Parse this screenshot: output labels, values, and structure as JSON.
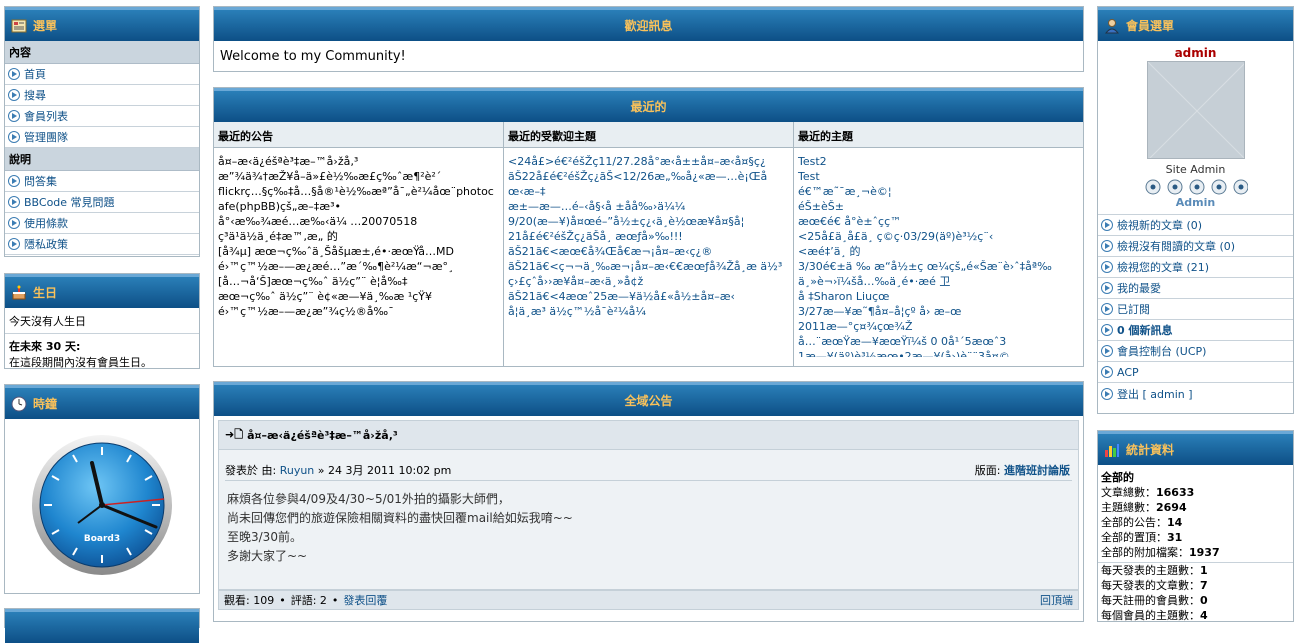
{
  "left": {
    "menu": {
      "title": "選單",
      "sections": [
        {
          "label": "內容",
          "items": [
            "首頁",
            "搜尋",
            "會員列表",
            "管理團隊"
          ]
        },
        {
          "label": "說明",
          "items": [
            "問答集",
            "BBCode 常見問題",
            "使用條款",
            "隱私政策"
          ]
        }
      ]
    },
    "birthday": {
      "title": "生日",
      "today": "今天沒有人生日",
      "next_label": "在未來 30 天:",
      "next_text": "在這段期間內沒有會員生日。"
    },
    "clock": {
      "title": "時鐘",
      "brand": "Board3"
    }
  },
  "welcome": {
    "title": "歡迎訊息",
    "text": "Welcome to my Community!"
  },
  "recent": {
    "title": "最近的",
    "columns": [
      {
        "head": "最近的公告",
        "body": "å¤–æ‹ä¿éšªè³‡æ–™å›žå‚³\næ”¾ä¾†æŽ¥å–ä»£è½‰æ£ç‰ˆæ¶²è²´\nflickrç…§ç‰‡å…§å®¹è½‰æª”å¯„è²¼åœ¨photocafe(phpBB)çš„æ–‡æ³•\nå°‹æ‰¾æ­é…æ‰‹ä¼ …20070518\nç³ä¹ä½ä¸é‡æ™‚æ„ 的\n[å¾µ] æœ¬ç‰ˆä¸Šåšµæ±‚é•·æœŸå…MD\né›™ç™½æ–—æ¿æ­é…”æ´‰¶è²¼æ“¬æ°¸\n[å…¬å‘Š]æœ¬ç‰ˆ ä½ç”¨ è¦å‰‡\næœ¬ç‰ˆ ä½ç”¨ è¢«æ—¥ä¸‰æ ¹çŸ¥\né›™ç™½æ–—æ¿æ”¾ç½®å‰¯"
      },
      {
        "head": "最近的受歡迎主題",
        "body": "<24å£>é€²éšŽç11/27.28å°æ‹å±±å¤–æ‹å¤§ç¿\nãŠ22å£é€²éšŽç¿ãŠ<12/26æ„‰å¿«æ—…è¡Œåœ‹æ–‡\næ±—æ—…é–‹å§‹å ±åå‰›ä¼¼\n9/20(æ—¥)å¤œé–”å½±ç¿‹ä¸è½œæ¥å¤§å¦\n21å£é€²éšŽç¿ãŠå¸ æœƒå»‰!!!\nãŠ21ã€<æœ€å¾Œå€æ¬¡å¤–æ‹ç¿®\nãŠ21ã€<ç¬¬ä¸‰æ¬¡å¤–æ‹€€æœƒå¾Žå­¸æ ä½³ç›£çˆå››æ¥å¤–æ‹ä¸»å¢ž\nãŠ21ã€<4æœˆ25æ—¥ä½å£«å½±å¤–æ‹\nå¦ä¸æ³ ä½ç™½å¯è²¼å¼ "
      },
      {
        "head": "最近的主題",
        "body": "Test2\nTest\né€™æ˜¯æ¸¬è©¦\néŠ±èŠ±\næœ€é€ å°è±ˆçç™\n<25å£ä¸å£ä¸ ç©ç·03/29(äº)è³½ç¨‹\n<æé‡’ä¸ 的\n3/30é€±ä ‰ æ“å½±ç œ¼çš„é«Šæ¨è›ˆ‡åª‰\nä¸»è¬›ï¼šå…‰ä¸é•·æé 卫\nå ‡Sharon Liuçœ\n3/27æ—¥æ˜¶å¤–å¦çº å› æ–œ\n2011æ—°ç¤¾çœ¾Ž\nå…¨æœŸæ—¥æœŸï¼š 0 0å¹´5æœˆ3\n1æ—¥(äº)è³½æœ•2æ—¥(å›)è¨¨3å¤©"
      }
    ]
  },
  "global": {
    "title": "全域公告",
    "topic_title": "å¤–æ‹ä¿éšªè³‡æ–™å›žå‚³",
    "posted_label": "發表於 由:",
    "author": "Ruyun",
    "date": "» 24 3月 2011 10:02 pm",
    "forum_label": "版面:",
    "forum": "進階班討論版",
    "lines": [
      "麻煩各位參與4/09及4/30~5/01外拍的攝影大師們，",
      "尚未回傳您們的旅遊保險相關資料的盡快回覆mail給如妘我唷~~",
      "至晚3/30前。",
      "多謝大家了~~"
    ],
    "footer_views": "觀看: 109",
    "footer_replies": "評語: 2",
    "footer_reply_link": "發表回覆",
    "footer_top": "回頂端"
  },
  "right": {
    "user_menu": {
      "title": "會員選單",
      "username": "admin",
      "rank": "Site Admin",
      "rank_label": "Admin",
      "items": [
        "檢視新的文章 (0)",
        "檢視沒有閱讀的文章 (0)",
        "檢視您的文章 (21)",
        "我的最愛",
        "已訂閱",
        "0 個新訊息",
        "會員控制台 (UCP)",
        "ACP",
        "登出 [ admin ]"
      ]
    },
    "stats": {
      "title": "統計資料",
      "section": "全部的",
      "rows": [
        {
          "label": "文章總數：",
          "value": "16633"
        },
        {
          "label": "主題總數：",
          "value": "2694"
        },
        {
          "label": "全部的公告：",
          "value": "14"
        },
        {
          "label": "全部的置頂：",
          "value": "31"
        },
        {
          "label": "全部的附加檔案：",
          "value": "1937"
        }
      ],
      "daily": [
        {
          "label": "每天發表的主題數：",
          "value": "1"
        },
        {
          "label": "每天發表的文章數：",
          "value": "7"
        },
        {
          "label": "每天註冊的會員數：",
          "value": "0"
        },
        {
          "label": "每個會員的主題數：",
          "value": "4"
        }
      ]
    }
  },
  "colors": {
    "header_top": "#2a7fb8",
    "header_bottom": "#0d4f86",
    "header_text": "#f8c15b",
    "link": "#105289"
  }
}
